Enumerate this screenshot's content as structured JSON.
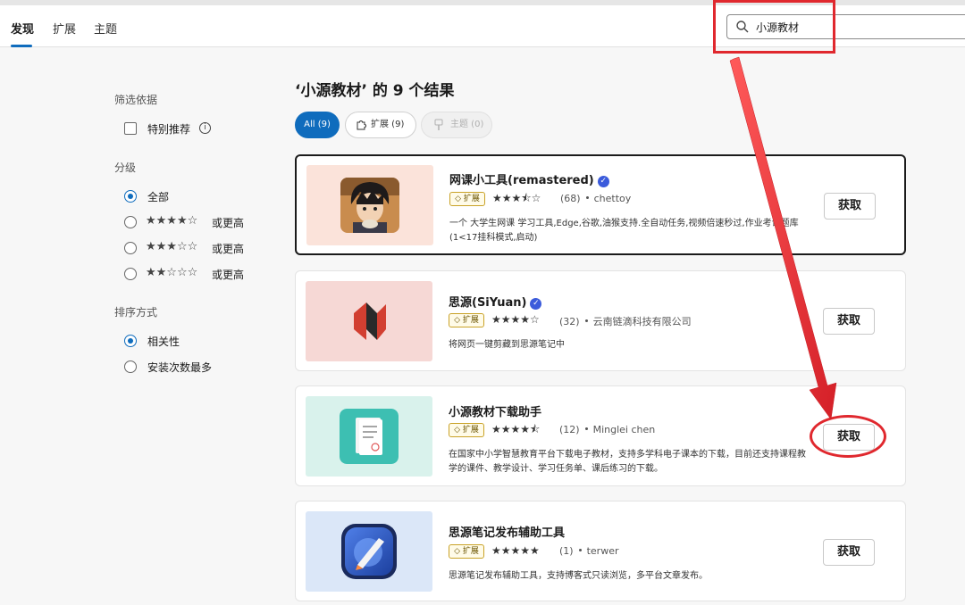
{
  "header": {
    "tabs": [
      {
        "label": "发现"
      },
      {
        "label": "扩展"
      },
      {
        "label": "主题"
      }
    ],
    "search_value": "小源教材"
  },
  "sidebar": {
    "filter_label": "筛选依据",
    "featured_label": "特别推荐",
    "rating_label": "分级",
    "rating_all": "全部",
    "rating_options": [
      {
        "stars": "★★★★☆",
        "suffix": "或更高"
      },
      {
        "stars": "★★★☆☆",
        "suffix": "或更高"
      },
      {
        "stars": "★★☆☆☆",
        "suffix": "或更高"
      }
    ],
    "sort_label": "排序方式",
    "sort_relevance": "相关性",
    "sort_installs": "安装次数最多"
  },
  "results": {
    "title": "‘小源教材’ 的 9 个结果",
    "pills": {
      "all": "All (9)",
      "ext": "扩展 (9)",
      "theme": "主题 (0)"
    },
    "items": [
      {
        "title": "网课小工具(remastered)",
        "badge": "扩展",
        "rating": 3.5,
        "stars": "★★★⯪☆",
        "count": "(68)",
        "author": "chettoy",
        "desc": "一个 大学生网课 学习工具,Edge,谷歌,油猴支持.全自动任务,视频倍速秒过,作业考试题库(1<17挂科模式,启动)",
        "button": "获取"
      },
      {
        "title": "思源(SiYuan)",
        "badge": "扩展",
        "rating": 4,
        "stars": "★★★★☆",
        "count": "(32)",
        "author": "云南链滴科技有限公司",
        "desc": "将网页一键剪藏到思源笔记中",
        "button": "获取"
      },
      {
        "title": "小源教材下载助手",
        "badge": "扩展",
        "rating": 4.5,
        "stars": "★★★★⯪",
        "count": "(12)",
        "author": "Minglei chen",
        "desc": "在国家中小学智慧教育平台下载电子教材，支持多学科电子课本的下载，目前还支持课程教学的课件、教学设计、学习任务单、课后练习的下载。",
        "button": "获取"
      },
      {
        "title": "思源笔记发布辅助工具",
        "badge": "扩展",
        "rating": 5,
        "stars": "★★★★★",
        "count": "(1)",
        "author": "terwer",
        "desc": "思源笔记发布辅助工具，支持博客式只读浏览，多平台文章发布。",
        "button": "获取"
      }
    ]
  },
  "colors": {
    "accent": "#0f6cbd",
    "annotation": "#e0282e"
  }
}
